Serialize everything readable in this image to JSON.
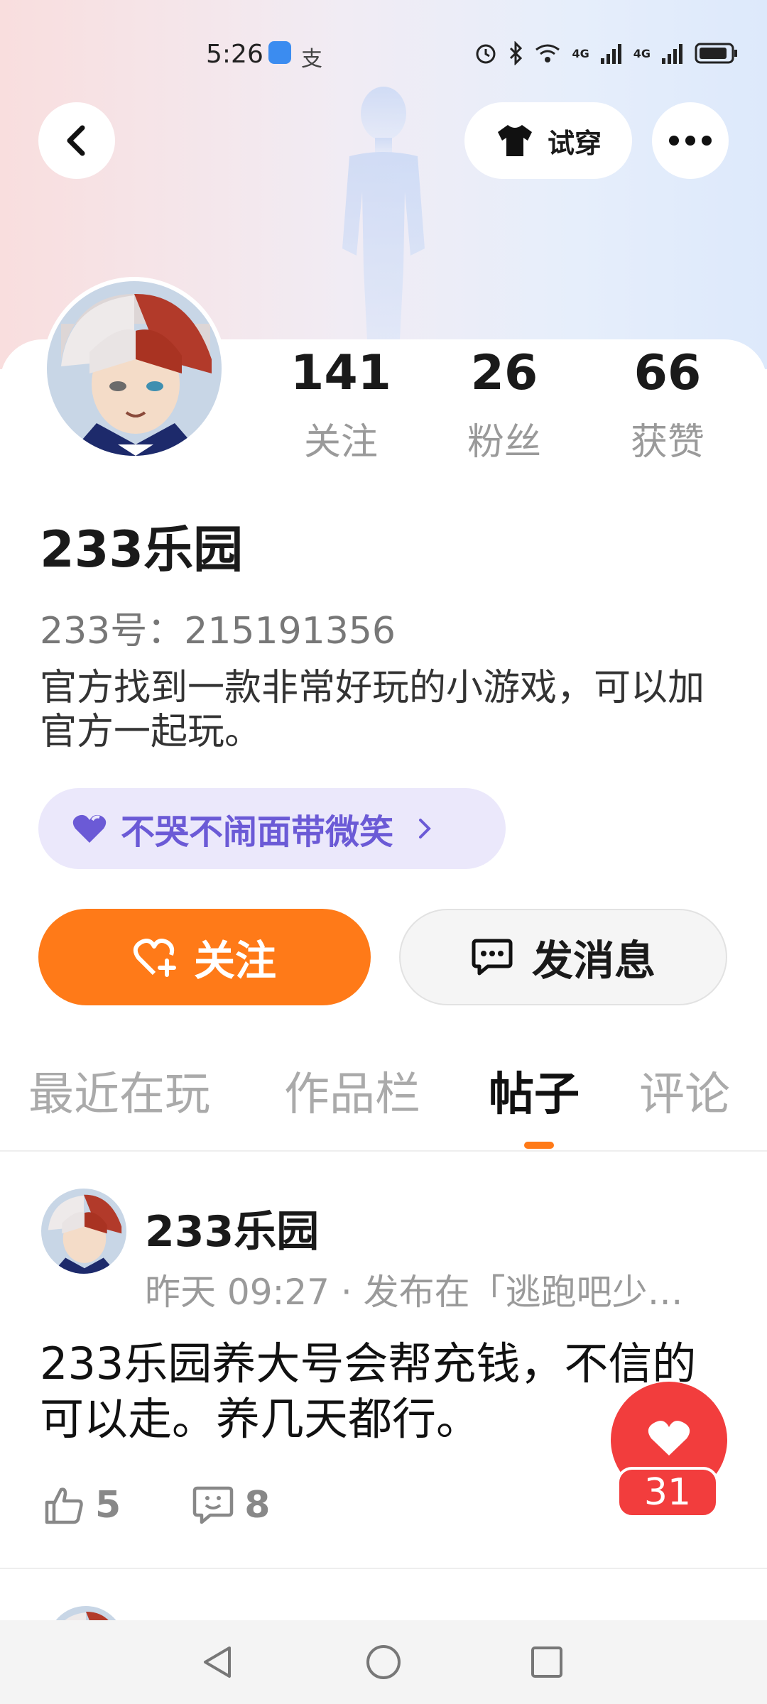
{
  "status_bar": {
    "time": "5:26",
    "network_label_1": "4G",
    "network_label_2": "4G"
  },
  "header": {
    "back_icon": "chevron-left-icon",
    "tryon_label": "试穿",
    "more_icon": "more-dots-icon"
  },
  "profile": {
    "stats": [
      {
        "value": "141",
        "label": "关注"
      },
      {
        "value": "26",
        "label": "粉丝"
      },
      {
        "value": "66",
        "label": "获赞"
      }
    ],
    "name": "233乐园",
    "uid": "233号：215191356",
    "bio": "官方找到一款非常好玩的小游戏，可以加官方一起玩。",
    "tag": "不哭不闹面带微笑"
  },
  "actions": {
    "follow_label": "关注",
    "message_label": "发消息"
  },
  "tabs": [
    "最近在玩",
    "作品栏",
    "帖子",
    "评论"
  ],
  "active_tab_index": 2,
  "post": {
    "author": "233乐园",
    "meta": "昨天 09:27 · 发布在「逃跑吧少…",
    "text": "233乐园养大号会帮充钱，不信的可以走。养几天都行。",
    "likes": "5",
    "comments": "8"
  },
  "floating_like": {
    "count": "31"
  },
  "colors": {
    "accent": "#ff7a18",
    "tag_bg": "#ebe8fb",
    "tag_text": "#6b5ad6",
    "like_red": "#f23d3d"
  }
}
